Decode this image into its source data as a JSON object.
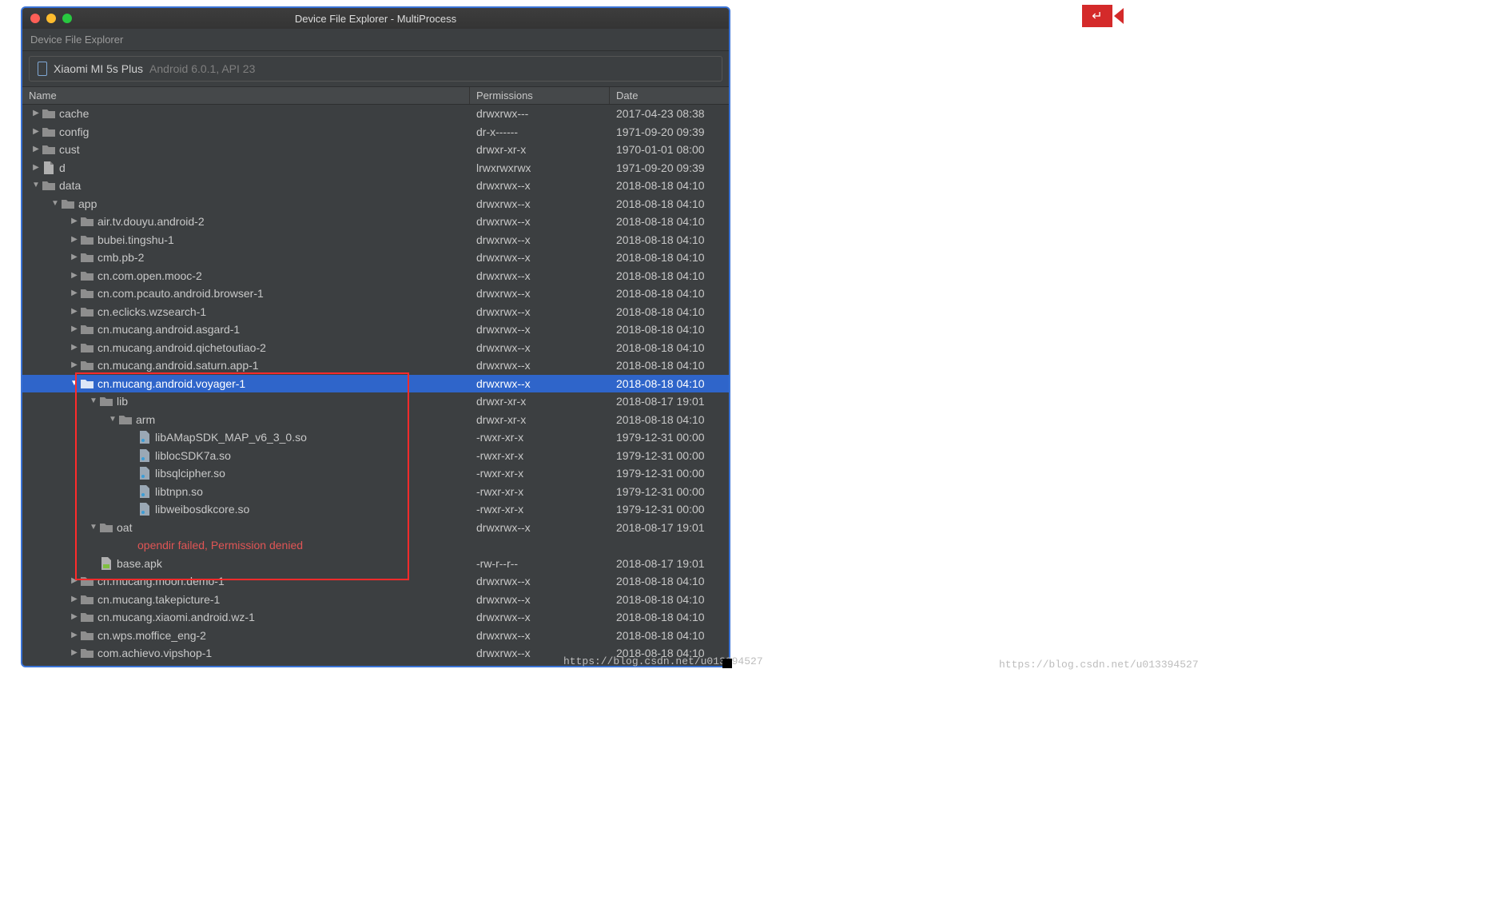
{
  "window": {
    "title": "Device File Explorer - MultiProcess"
  },
  "panel": {
    "title": "Device File Explorer"
  },
  "device": {
    "name": "Xiaomi MI 5s Plus",
    "meta": "Android 6.0.1, API 23"
  },
  "columns": {
    "name": "Name",
    "perm": "Permissions",
    "date": "Date"
  },
  "watermark1": "https://blog.csdn.net/u013394527",
  "watermark2": "https://blog.csdn.net/u013394527",
  "rows": [
    {
      "depth": 0,
      "arrow": "right",
      "type": "folder",
      "label": "cache",
      "perm": "drwxrwx---",
      "date": "2017-04-23 08:38"
    },
    {
      "depth": 0,
      "arrow": "right",
      "type": "folder",
      "label": "config",
      "perm": "dr-x------",
      "date": "1971-09-20 09:39"
    },
    {
      "depth": 0,
      "arrow": "right",
      "type": "folder",
      "label": "cust",
      "perm": "drwxr-xr-x",
      "date": "1970-01-01 08:00"
    },
    {
      "depth": 0,
      "arrow": "right",
      "type": "file",
      "label": "d",
      "perm": "lrwxrwxrwx",
      "date": "1971-09-20 09:39"
    },
    {
      "depth": 0,
      "arrow": "down",
      "type": "folder",
      "label": "data",
      "perm": "drwxrwx--x",
      "date": "2018-08-18 04:10"
    },
    {
      "depth": 1,
      "arrow": "down",
      "type": "folder",
      "label": "app",
      "perm": "drwxrwx--x",
      "date": "2018-08-18 04:10"
    },
    {
      "depth": 2,
      "arrow": "right",
      "type": "folder",
      "label": "air.tv.douyu.android-2",
      "perm": "drwxrwx--x",
      "date": "2018-08-18 04:10"
    },
    {
      "depth": 2,
      "arrow": "right",
      "type": "folder",
      "label": "bubei.tingshu-1",
      "perm": "drwxrwx--x",
      "date": "2018-08-18 04:10"
    },
    {
      "depth": 2,
      "arrow": "right",
      "type": "folder",
      "label": "cmb.pb-2",
      "perm": "drwxrwx--x",
      "date": "2018-08-18 04:10"
    },
    {
      "depth": 2,
      "arrow": "right",
      "type": "folder",
      "label": "cn.com.open.mooc-2",
      "perm": "drwxrwx--x",
      "date": "2018-08-18 04:10"
    },
    {
      "depth": 2,
      "arrow": "right",
      "type": "folder",
      "label": "cn.com.pcauto.android.browser-1",
      "perm": "drwxrwx--x",
      "date": "2018-08-18 04:10"
    },
    {
      "depth": 2,
      "arrow": "right",
      "type": "folder",
      "label": "cn.eclicks.wzsearch-1",
      "perm": "drwxrwx--x",
      "date": "2018-08-18 04:10"
    },
    {
      "depth": 2,
      "arrow": "right",
      "type": "folder",
      "label": "cn.mucang.android.asgard-1",
      "perm": "drwxrwx--x",
      "date": "2018-08-18 04:10"
    },
    {
      "depth": 2,
      "arrow": "right",
      "type": "folder",
      "label": "cn.mucang.android.qichetoutiao-2",
      "perm": "drwxrwx--x",
      "date": "2018-08-18 04:10"
    },
    {
      "depth": 2,
      "arrow": "right",
      "type": "folder",
      "label": "cn.mucang.android.saturn.app-1",
      "perm": "drwxrwx--x",
      "date": "2018-08-18 04:10"
    },
    {
      "depth": 2,
      "arrow": "down",
      "type": "folder",
      "label": "cn.mucang.android.voyager-1",
      "perm": "drwxrwx--x",
      "date": "2018-08-18 04:10",
      "selected": true
    },
    {
      "depth": 3,
      "arrow": "down",
      "type": "folder",
      "label": "lib",
      "perm": "drwxr-xr-x",
      "date": "2018-08-17 19:01"
    },
    {
      "depth": 4,
      "arrow": "down",
      "type": "folder",
      "label": "arm",
      "perm": "drwxr-xr-x",
      "date": "2018-08-18 04:10"
    },
    {
      "depth": 5,
      "arrow": "",
      "type": "sofile",
      "label": "libAMapSDK_MAP_v6_3_0.so",
      "perm": "-rwxr-xr-x",
      "date": "1979-12-31 00:00"
    },
    {
      "depth": 5,
      "arrow": "",
      "type": "sofile",
      "label": "liblocSDK7a.so",
      "perm": "-rwxr-xr-x",
      "date": "1979-12-31 00:00"
    },
    {
      "depth": 5,
      "arrow": "",
      "type": "sofile",
      "label": "libsqlcipher.so",
      "perm": "-rwxr-xr-x",
      "date": "1979-12-31 00:00"
    },
    {
      "depth": 5,
      "arrow": "",
      "type": "sofile",
      "label": "libtnpn.so",
      "perm": "-rwxr-xr-x",
      "date": "1979-12-31 00:00"
    },
    {
      "depth": 5,
      "arrow": "",
      "type": "sofile",
      "label": "libweibosdkcore.so",
      "perm": "-rwxr-xr-x",
      "date": "1979-12-31 00:00"
    },
    {
      "depth": 3,
      "arrow": "down",
      "type": "folder",
      "label": "oat",
      "perm": "drwxrwx--x",
      "date": "2018-08-17 19:01"
    },
    {
      "depth": 5,
      "arrow": "",
      "type": "error",
      "label": "opendir failed, Permission denied",
      "perm": "",
      "date": ""
    },
    {
      "depth": 3,
      "arrow": "",
      "type": "apk",
      "label": "base.apk",
      "perm": "-rw-r--r--",
      "date": "2018-08-17 19:01"
    },
    {
      "depth": 2,
      "arrow": "right",
      "type": "folder",
      "label": "cn.mucang.moon.demo-1",
      "perm": "drwxrwx--x",
      "date": "2018-08-18 04:10"
    },
    {
      "depth": 2,
      "arrow": "right",
      "type": "folder",
      "label": "cn.mucang.takepicture-1",
      "perm": "drwxrwx--x",
      "date": "2018-08-18 04:10"
    },
    {
      "depth": 2,
      "arrow": "right",
      "type": "folder",
      "label": "cn.mucang.xiaomi.android.wz-1",
      "perm": "drwxrwx--x",
      "date": "2018-08-18 04:10"
    },
    {
      "depth": 2,
      "arrow": "right",
      "type": "folder",
      "label": "cn.wps.moffice_eng-2",
      "perm": "drwxrwx--x",
      "date": "2018-08-18 04:10"
    },
    {
      "depth": 2,
      "arrow": "right",
      "type": "folder",
      "label": "com.achievo.vipshop-1",
      "perm": "drwxrwx--x",
      "date": "2018-08-18 04:10"
    }
  ]
}
